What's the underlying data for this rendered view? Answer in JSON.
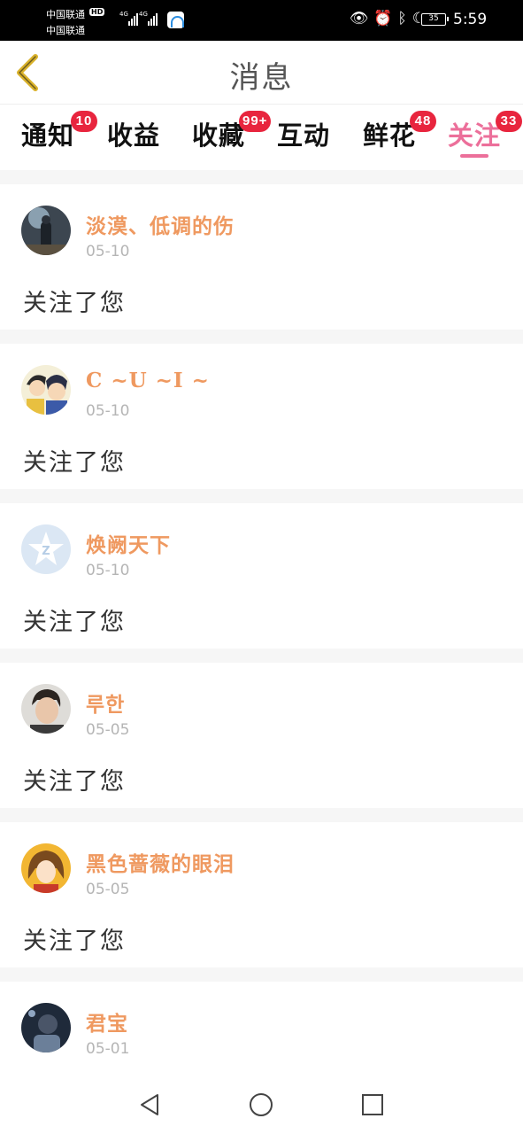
{
  "status": {
    "carrier1": "中国联通",
    "carrier2": "中国联通",
    "hd": "HD",
    "net1": "4G",
    "net2": "4G",
    "battery": "35",
    "time": "5:59"
  },
  "header": {
    "title": "消息"
  },
  "tabs": [
    {
      "label": "通知",
      "badge": "10"
    },
    {
      "label": "收益",
      "badge": ""
    },
    {
      "label": "收藏",
      "badge": "99+"
    },
    {
      "label": "互动",
      "badge": ""
    },
    {
      "label": "鲜花",
      "badge": "48"
    },
    {
      "label": "关注",
      "badge": "33",
      "active": true
    }
  ],
  "feed": [
    {
      "name": "淡漠、低调的伤",
      "date": "05-10",
      "message": "关注了您",
      "avatar_icon": "dark-figure-avatar"
    },
    {
      "name": "C ~U ~I ~",
      "date": "05-10",
      "message": "关注了您",
      "avatar_icon": "anime-couple-avatar"
    },
    {
      "name": "焕阙天下",
      "date": "05-10",
      "message": "关注了您",
      "avatar_icon": "default-star-avatar"
    },
    {
      "name": "루한",
      "date": "05-05",
      "message": "关注了您",
      "avatar_icon": "person-photo-avatar"
    },
    {
      "name": "黑色蔷薇的眼泪",
      "date": "05-05",
      "message": "关注了您",
      "avatar_icon": "anime-girl-avatar"
    },
    {
      "name": "君宝",
      "date": "05-01",
      "message": "",
      "avatar_icon": "dark-photo-avatar"
    }
  ],
  "colors": {
    "accent": "#ec6f9a",
    "username": "#ef9960",
    "badge": "#e8253e",
    "back": "#d9b12a"
  }
}
